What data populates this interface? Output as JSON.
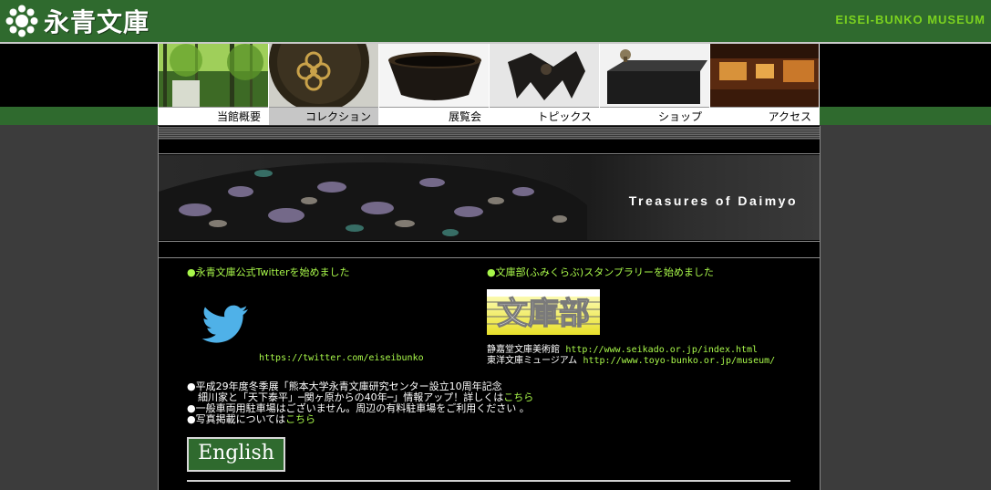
{
  "header": {
    "site_title": "永青文庫",
    "english_title": "EISEI-BUNKO MUSEUM",
    "logo_icon": "nine-circle-crest-icon",
    "colors": {
      "green": "#2f6a2e",
      "accent": "#7bd21f"
    }
  },
  "nav": {
    "items": [
      {
        "label": "当館概要",
        "icon": "forest-photo",
        "active": false
      },
      {
        "label": "コレクション",
        "icon": "lacquer-bowl-photo",
        "active": true
      },
      {
        "label": "展覧会",
        "icon": "tea-bowl-photo",
        "active": false
      },
      {
        "label": "トピックス",
        "icon": "iron-sculpture-photo",
        "active": false
      },
      {
        "label": "ショップ",
        "icon": "box-photo",
        "active": false
      },
      {
        "label": "アクセス",
        "icon": "interior-photo",
        "active": false
      }
    ]
  },
  "banner": {
    "text": "Treasures of Daimyo"
  },
  "twitter": {
    "heading": "永青文庫公式Twitterを始めました",
    "url": "https://twitter.com/eiseibunko",
    "icon": "twitter-bird-icon"
  },
  "bunko": {
    "heading": "文庫部(ふみくらぶ)スタンプラリーを始めました",
    "logo_text": "文庫部",
    "line1_name": "静嘉堂文庫美術館",
    "line1_url": "http://www.seikado.or.jp/index.html",
    "line2_name": "東洋文庫ミュージアム",
    "line2_url": "http://www.toyo-bunko.or.jp/museum/"
  },
  "notices": {
    "n1_line1": "平成29年度冬季展「熊本大学永青文庫研究センター設立10周年記念",
    "n1_line2": "細川家と「天下泰平」─関ヶ原からの40年─」情報アップ！詳しくは",
    "n1_link": "こちら",
    "n2": "一般車両用駐車場はございません。周辺の有料駐車場をご利用ください 。",
    "n3": "写真掲載については",
    "n3_link": "こちら"
  },
  "english_button": {
    "label": "English"
  }
}
